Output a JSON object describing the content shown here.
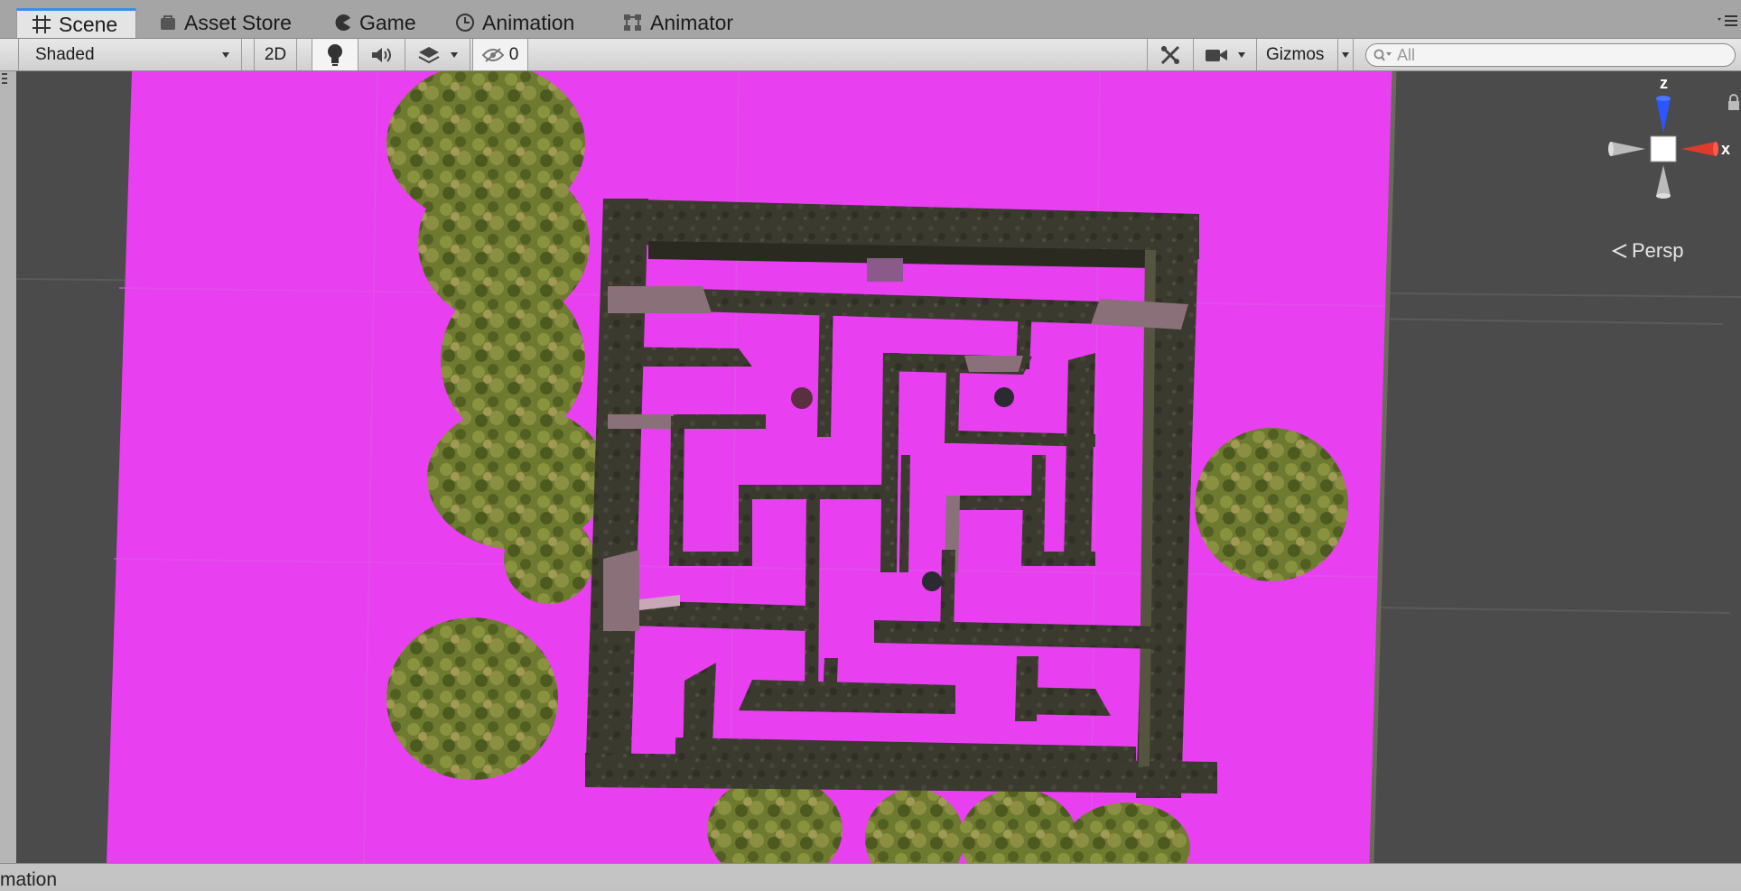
{
  "tabs": [
    {
      "label": "Scene",
      "icon": "grid-icon",
      "active": true
    },
    {
      "label": "Asset Store",
      "icon": "store-bag-icon",
      "active": false
    },
    {
      "label": "Game",
      "icon": "pacman-icon",
      "active": false
    },
    {
      "label": "Animation",
      "icon": "clock-icon",
      "active": false
    },
    {
      "label": "Animator",
      "icon": "animator-nodes-icon",
      "active": false
    }
  ],
  "toolbar": {
    "draw_mode": "Shaded",
    "mode_2d": "2D",
    "lighting_icon": "lightbulb-icon",
    "audio_icon": "speaker-icon",
    "effects_icon": "layers-icon",
    "hidden_count": "0",
    "tools_icon": "wrench-cross-icon",
    "camera_icon": "camera-icon",
    "gizmos_label": "Gizmos",
    "search_placeholder": "All"
  },
  "scene_gizmo": {
    "axis_z": "z",
    "axis_x": "x",
    "projection": "Persp",
    "lock_icon": "lock-icon"
  },
  "bottom_panel": {
    "label_fragment": "mation"
  },
  "colors": {
    "ground": "#e83ff0",
    "wall": "#3a3a2e",
    "tree": "#6b7a2c",
    "accent": "#3a8ee6"
  }
}
